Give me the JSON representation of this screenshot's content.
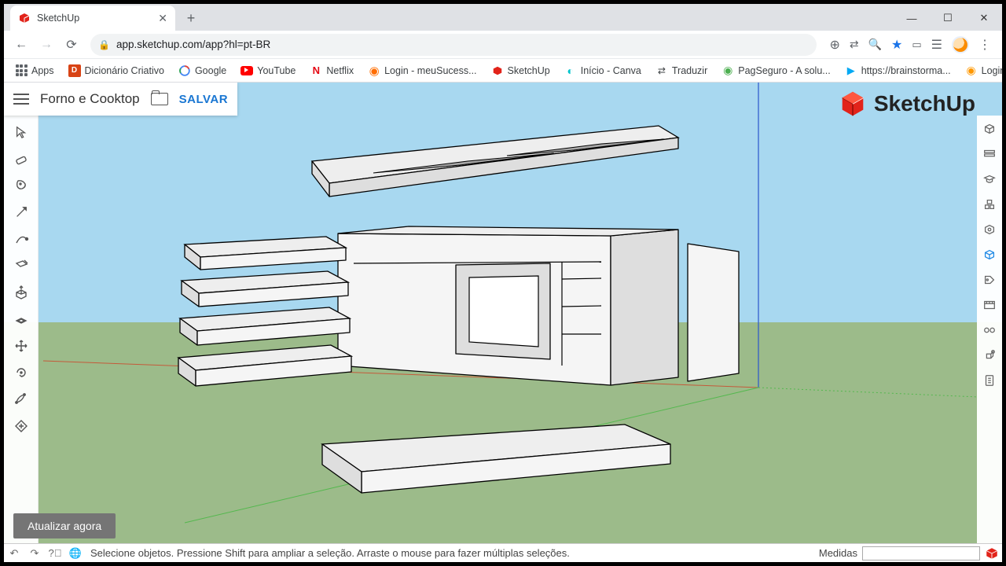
{
  "browser": {
    "tab_title": "SketchUp",
    "url": "app.sketchup.com/app?hl=pt-BR",
    "bookmarks": [
      "Apps",
      "Dicionário Criativo",
      "Google",
      "YouTube",
      "Netflix",
      "Login - meuSucess...",
      "SketchUp",
      "Início - Canva",
      "Traduzir",
      "PagSeguro - A solu...",
      "https://brainstorma...",
      "Login"
    ]
  },
  "app": {
    "file_name": "Forno e Cooktop",
    "save_label": "SALVAR",
    "brand": "SketchUp",
    "update_label": "Atualizar agora",
    "status_hint": "Selecione objetos. Pressione Shift para ampliar a seleção. Arraste o mouse para fazer múltiplas seleções.",
    "measure_label": "Medidas"
  }
}
